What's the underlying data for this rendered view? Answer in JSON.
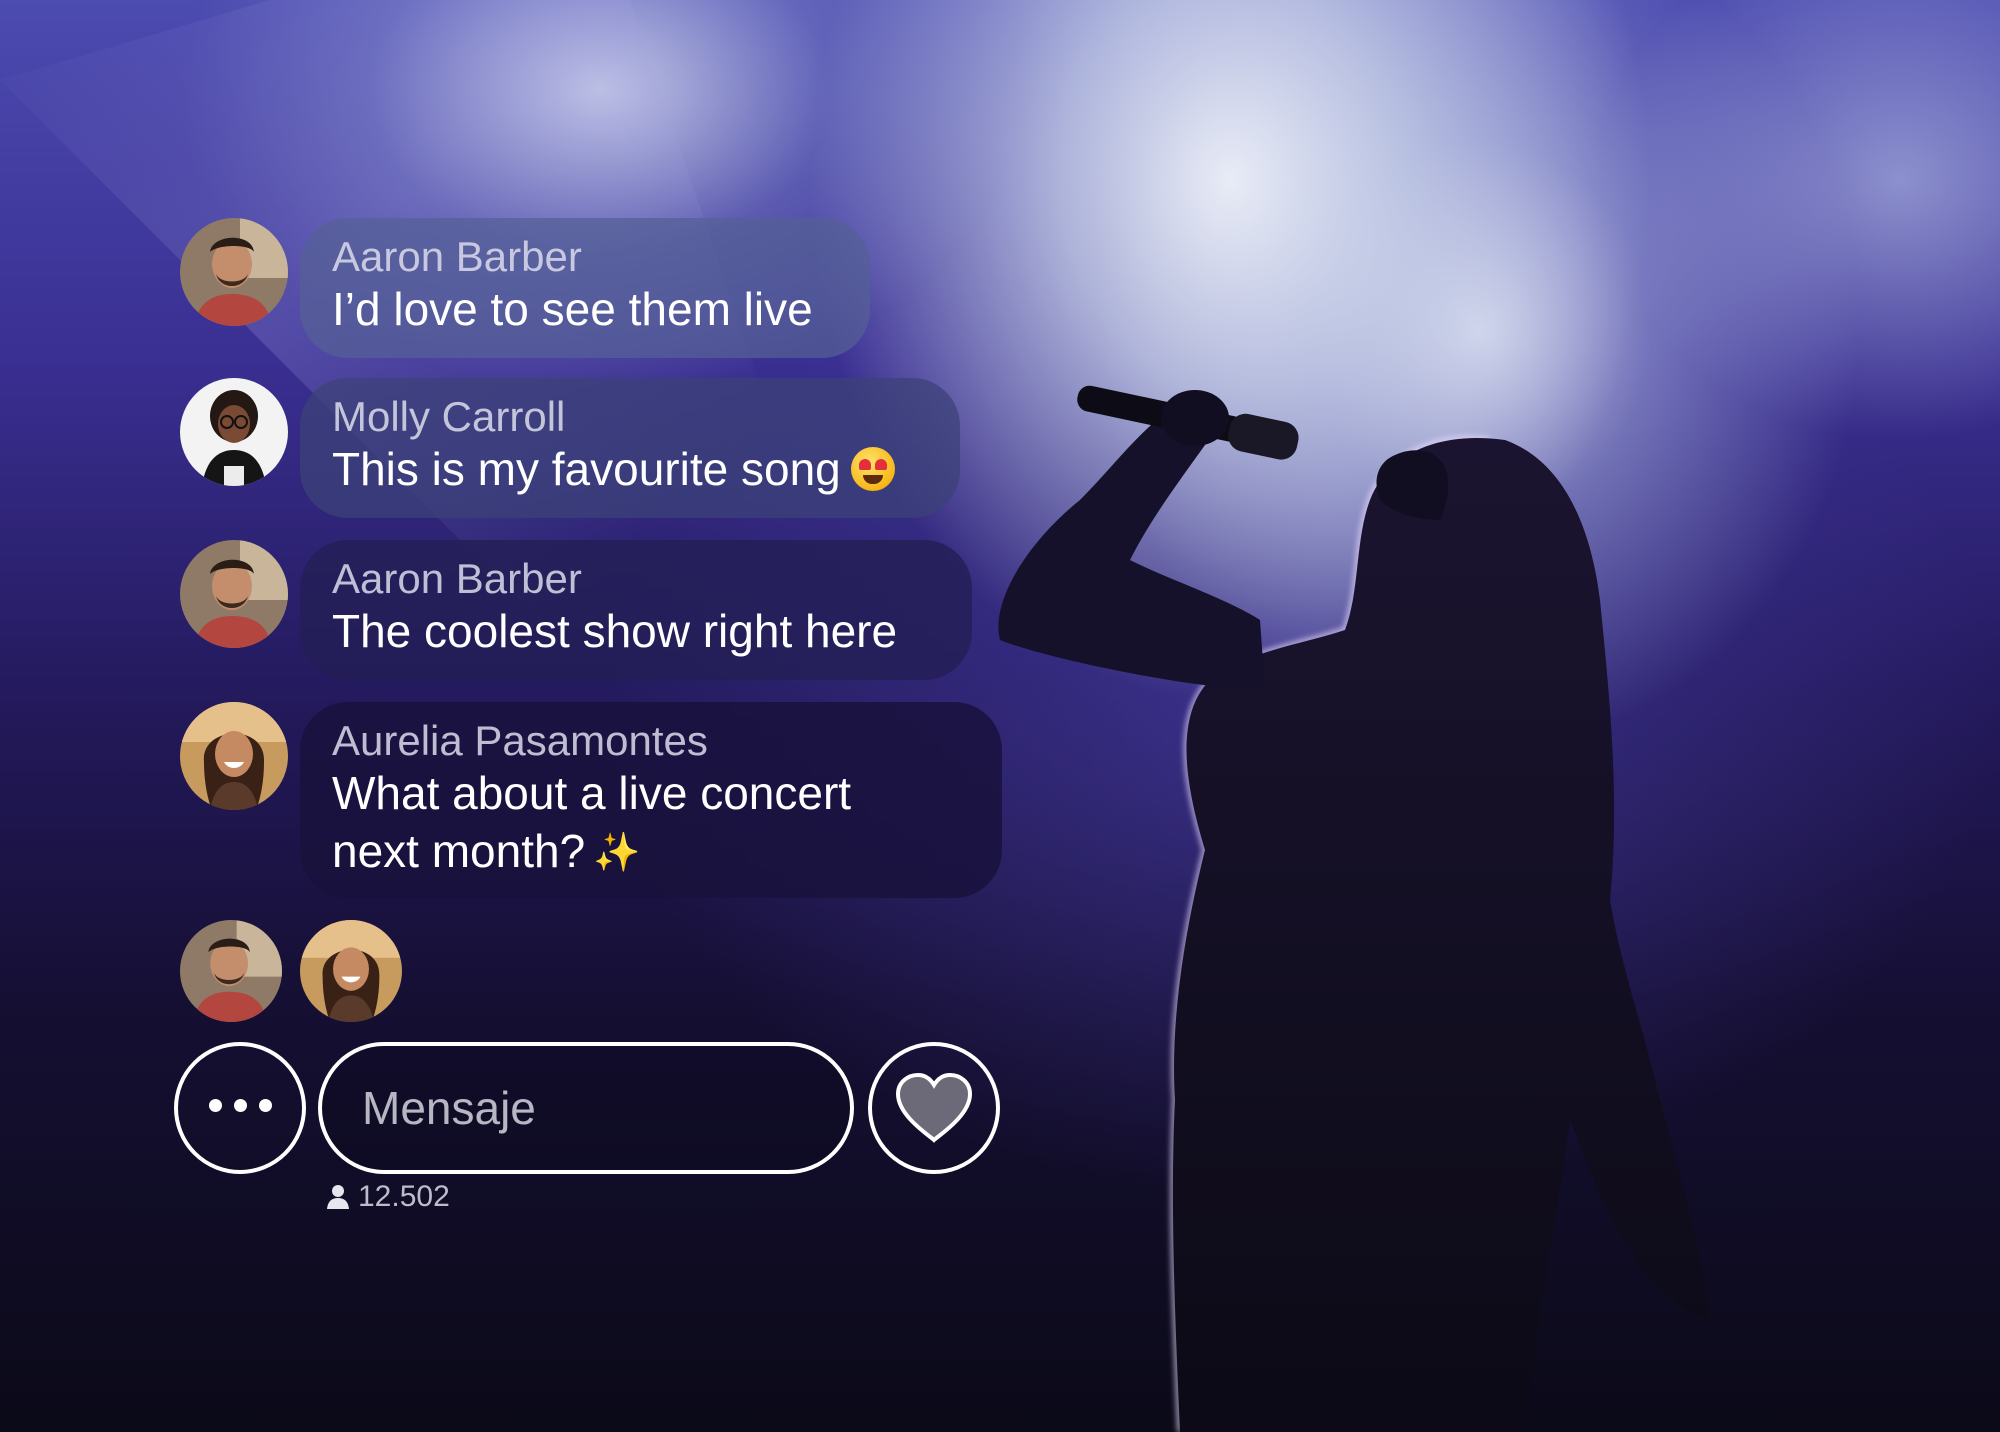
{
  "chat": {
    "messages": [
      {
        "author": "Aaron Barber",
        "text": "I’d love to see them live",
        "avatar": "aaron-avatar"
      },
      {
        "author": "Molly Carroll",
        "text": "This is my favourite song",
        "emoji": "heart-eyes-emoji",
        "avatar": "molly-avatar"
      },
      {
        "author": "Aaron Barber",
        "text": "The coolest show right here",
        "avatar": "aaron-avatar"
      },
      {
        "author": "Aurelia Pasamontes",
        "text_line1": "What about a live concert",
        "text_line2": "next month?",
        "emoji": "sparkles-emoji",
        "avatar": "aurelia-avatar"
      }
    ],
    "typing": [
      "aaron-avatar",
      "aurelia-avatar"
    ]
  },
  "controls": {
    "more_icon": "ellipsis-icon",
    "message_placeholder": "Mensaje",
    "like_icon": "heart-icon"
  },
  "stats": {
    "viewer_icon": "person-icon",
    "viewer_count": "12.502"
  },
  "colors": {
    "accent_white": "#ffffff",
    "background_top": "#4c4bb0",
    "background_bottom": "#0b0a18"
  }
}
